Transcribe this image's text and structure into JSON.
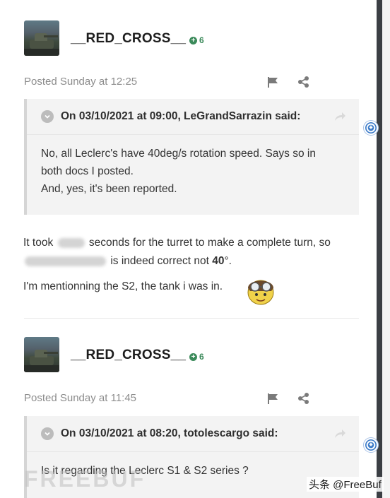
{
  "posts": [
    {
      "username": "__RED_CROSS__",
      "reputation": "6",
      "posted": "Posted Sunday at 12:25",
      "quote": {
        "cite": "On 03/10/2021 at 09:00, LeGrandSarrazin said:",
        "lines": [
          "No, all Leclerc's have 40deg/s rotation speed. Says so in",
          "both docs I posted.",
          "And, yes, it's been reported."
        ]
      },
      "body": {
        "line1_before": "It took",
        "line1_after": "seconds for the turret to make a complete turn, so",
        "line2_after": "is indeed correct not",
        "line2_bold": "40",
        "line2_end": "°.",
        "line3": "I'm mentionning the S2, the tank i was in."
      }
    },
    {
      "username": "__RED_CROSS__",
      "reputation": "6",
      "posted": "Posted Sunday at 11:45",
      "quote": {
        "cite": "On 03/10/2021 at 08:20, totolescargo said:",
        "lines": [
          "Is it regarding the Leclerc S1 & S2 series ?"
        ]
      }
    }
  ],
  "watermark": "头条 @FreeBuf",
  "ghost_logo": "FREEBUF",
  "colors": {
    "accent": "#3d7cc9",
    "reputation": "#3b8a5a",
    "rail": "#3b3f44"
  }
}
